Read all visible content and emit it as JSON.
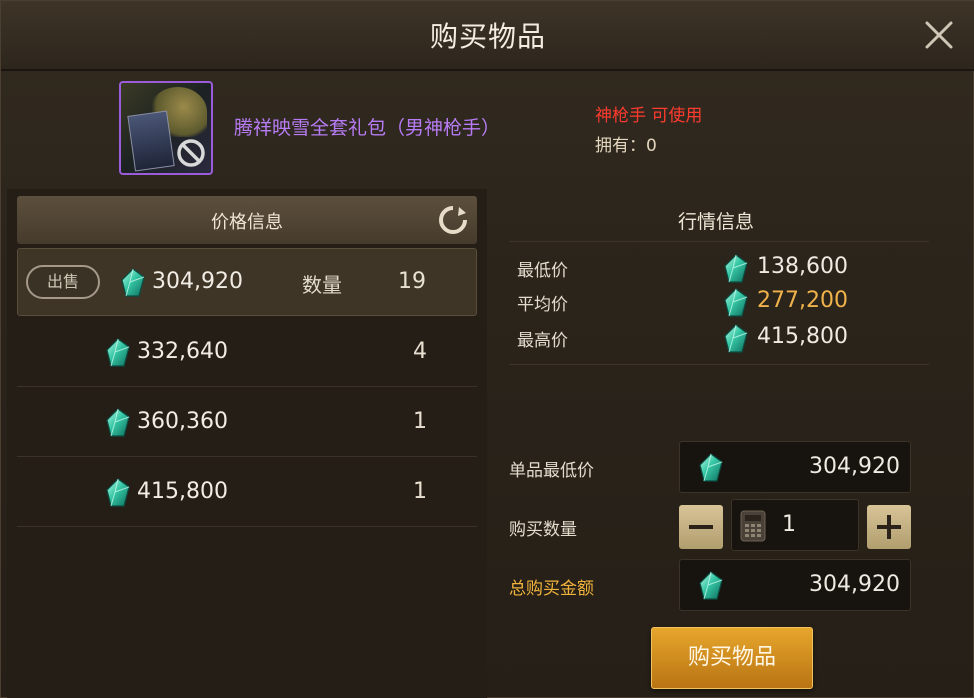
{
  "dialog": {
    "title": "购买物品"
  },
  "item": {
    "name": "腾祥映雪全套礼包（男神枪手）",
    "class_requirement": "神枪手 可使用",
    "owned": "拥有：0"
  },
  "price_panel": {
    "header": "价格信息",
    "sell_label": "出售",
    "qty_label": "数量",
    "rows": [
      {
        "price": "304,920",
        "qty": "19"
      },
      {
        "price": "332,640",
        "qty": "4"
      },
      {
        "price": "360,360",
        "qty": "1"
      },
      {
        "price": "415,800",
        "qty": "1"
      }
    ]
  },
  "market": {
    "title": "行情信息",
    "min_label": "最低价",
    "min_value": "138,600",
    "avg_label": "平均价",
    "avg_value": "277,200",
    "max_label": "最高价",
    "max_value": "415,800"
  },
  "purchase": {
    "unit_min_label": "单品最低价",
    "unit_min_value": "304,920",
    "quantity_label": "购买数量",
    "quantity_value": "1",
    "total_label": "总购买金额",
    "total_value": "304,920",
    "buy_button": "购买物品"
  },
  "colors": {
    "item_name": "#b77cf5",
    "class_req": "#ff3b2f",
    "avg_price": "#f0b24a",
    "total_label": "#f2b33c",
    "buy_button": "#d28f20"
  }
}
